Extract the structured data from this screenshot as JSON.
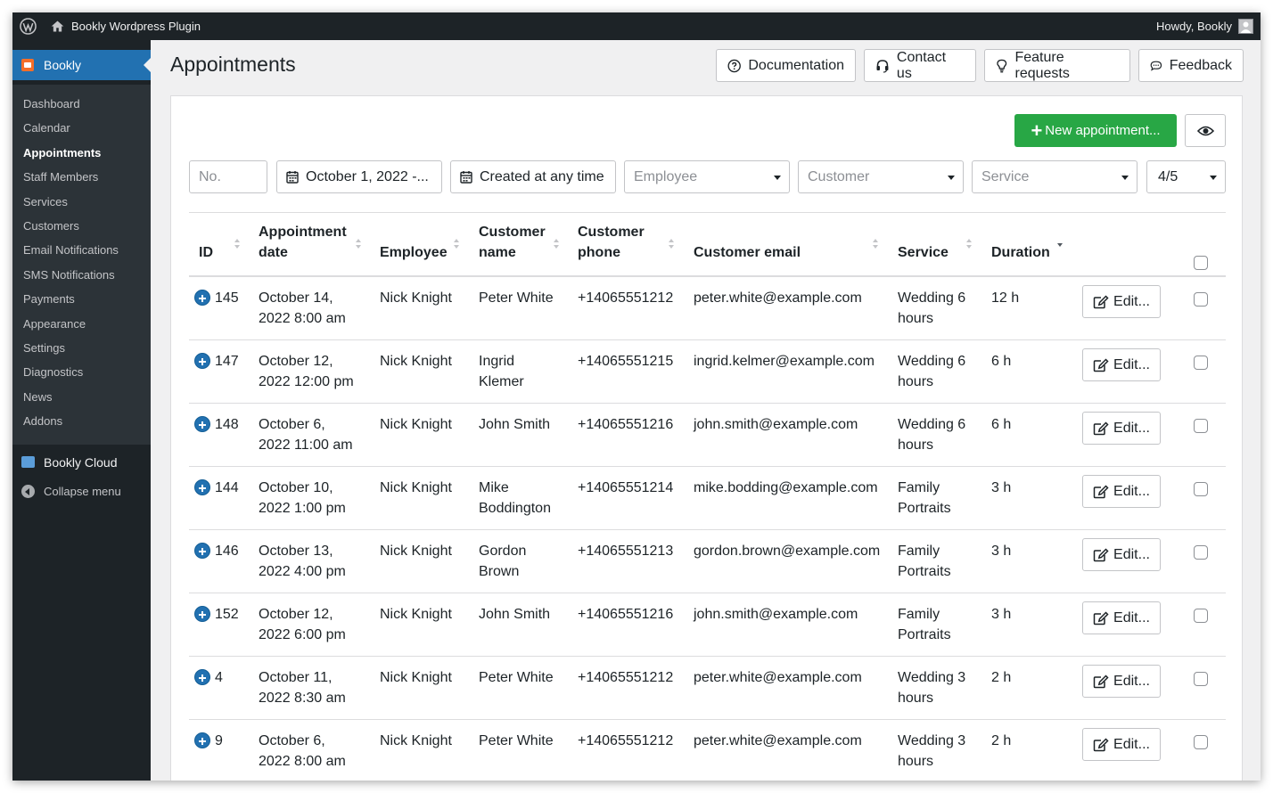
{
  "adminbar": {
    "site_name": "Bookly Wordpress Plugin",
    "howdy": "Howdy, Bookly"
  },
  "sidebar": {
    "top_label": "Bookly",
    "items": [
      {
        "label": "Dashboard"
      },
      {
        "label": "Calendar"
      },
      {
        "label": "Appointments",
        "current": true
      },
      {
        "label": "Staff Members"
      },
      {
        "label": "Services"
      },
      {
        "label": "Customers"
      },
      {
        "label": "Email Notifications"
      },
      {
        "label": "SMS Notifications"
      },
      {
        "label": "Payments"
      },
      {
        "label": "Appearance"
      },
      {
        "label": "Settings"
      },
      {
        "label": "Diagnostics"
      },
      {
        "label": "News"
      },
      {
        "label": "Addons"
      }
    ],
    "cloud_label": "Bookly Cloud",
    "collapse_label": "Collapse menu"
  },
  "header": {
    "title": "Appointments",
    "documentation": "Documentation",
    "contact": "Contact us",
    "feature_requests": "Feature requests",
    "feedback": "Feedback"
  },
  "toolbar": {
    "new_appointment": "New appointment..."
  },
  "filters": {
    "no_placeholder": "No.",
    "date_range": "October 1, 2022 -...",
    "created": "Created at any time",
    "employee": "Employee",
    "customer": "Customer",
    "service": "Service",
    "status": "4/5"
  },
  "table": {
    "headers": {
      "id": "ID",
      "date_line1": "Appointment",
      "date_line2": "date",
      "employee": "Employee",
      "cname_line1": "Customer",
      "cname_line2": "name",
      "cphone_line1": "Customer",
      "cphone_line2": "phone",
      "email": "Customer email",
      "service": "Service",
      "duration": "Duration"
    },
    "edit_label": "Edit...",
    "rows": [
      {
        "id": "145",
        "date1": "October 14,",
        "date2": "2022 8:00 am",
        "employee": "Nick Knight",
        "name1": "Peter White",
        "name2": "",
        "phone": "+14065551212",
        "email": "peter.white@example.com",
        "service1": "Wedding 6",
        "service2": "hours",
        "duration": "12 h"
      },
      {
        "id": "147",
        "date1": "October 12,",
        "date2": "2022 12:00 pm",
        "employee": "Nick Knight",
        "name1": "Ingrid",
        "name2": "Klemer",
        "phone": "+14065551215",
        "email": "ingrid.kelmer@example.com",
        "service1": "Wedding 6",
        "service2": "hours",
        "duration": "6 h"
      },
      {
        "id": "148",
        "date1": "October 6,",
        "date2": "2022 11:00 am",
        "employee": "Nick Knight",
        "name1": "John Smith",
        "name2": "",
        "phone": "+14065551216",
        "email": "john.smith@example.com",
        "service1": "Wedding 6",
        "service2": "hours",
        "duration": "6 h"
      },
      {
        "id": "144",
        "date1": "October 10,",
        "date2": "2022 1:00 pm",
        "employee": "Nick Knight",
        "name1": "Mike",
        "name2": "Boddington",
        "phone": "+14065551214",
        "email": "mike.bodding@example.com",
        "service1": "Family",
        "service2": "Portraits",
        "duration": "3 h"
      },
      {
        "id": "146",
        "date1": "October 13,",
        "date2": "2022 4:00 pm",
        "employee": "Nick Knight",
        "name1": "Gordon",
        "name2": "Brown",
        "phone": "+14065551213",
        "email": "gordon.brown@example.com",
        "service1": "Family",
        "service2": "Portraits",
        "duration": "3 h"
      },
      {
        "id": "152",
        "date1": "October 12,",
        "date2": "2022 6:00 pm",
        "employee": "Nick Knight",
        "name1": "John Smith",
        "name2": "",
        "phone": "+14065551216",
        "email": "john.smith@example.com",
        "service1": "Family",
        "service2": "Portraits",
        "duration": "3 h"
      },
      {
        "id": "4",
        "date1": "October 11,",
        "date2": "2022 8:30 am",
        "employee": "Nick Knight",
        "name1": "Peter White",
        "name2": "",
        "phone": "+14065551212",
        "email": "peter.white@example.com",
        "service1": "Wedding 3",
        "service2": "hours",
        "duration": "2 h"
      },
      {
        "id": "9",
        "date1": "October 6,",
        "date2": "2022 8:00 am",
        "employee": "Nick Knight",
        "name1": "Peter White",
        "name2": "",
        "phone": "+14065551212",
        "email": "peter.white@example.com",
        "service1": "Wedding 3",
        "service2": "hours",
        "duration": "2 h"
      }
    ]
  }
}
